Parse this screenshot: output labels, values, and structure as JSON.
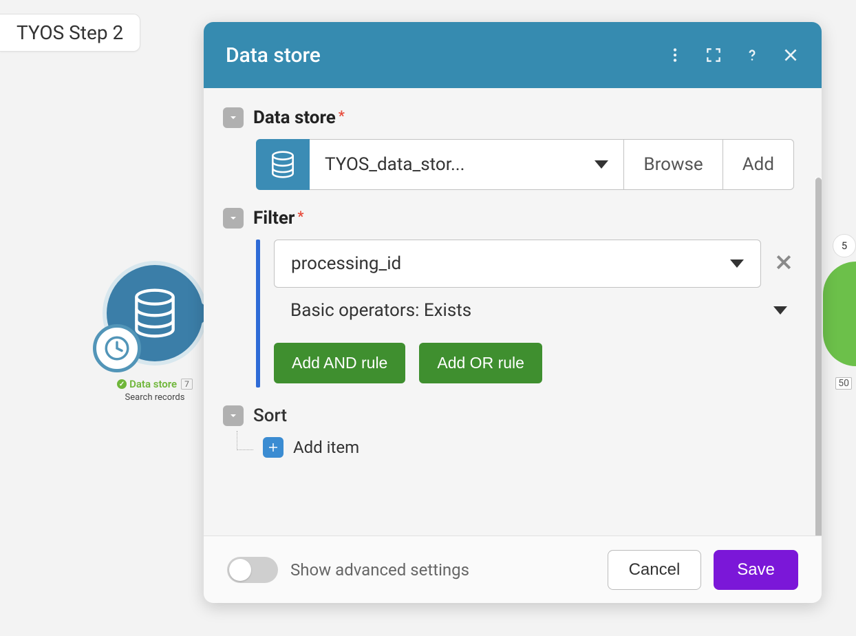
{
  "step_chip": "TYOS Step 2",
  "node": {
    "status_label": "Data store",
    "count": "7",
    "subtitle": "Search records"
  },
  "dialog": {
    "title": "Data store",
    "sections": {
      "datastore": {
        "label": "Data store",
        "selected": "TYOS_data_stor...",
        "browse": "Browse",
        "add": "Add"
      },
      "filter": {
        "label": "Filter",
        "field": "processing_id",
        "operator": "Basic operators: Exists",
        "add_and": "Add AND rule",
        "add_or": "Add OR rule"
      },
      "sort": {
        "label": "Sort",
        "add_item": "Add item"
      }
    },
    "footer": {
      "advanced_label": "Show advanced settings",
      "cancel": "Cancel",
      "save": "Save"
    }
  },
  "edge": {
    "fifty": "50",
    "five": "5"
  }
}
